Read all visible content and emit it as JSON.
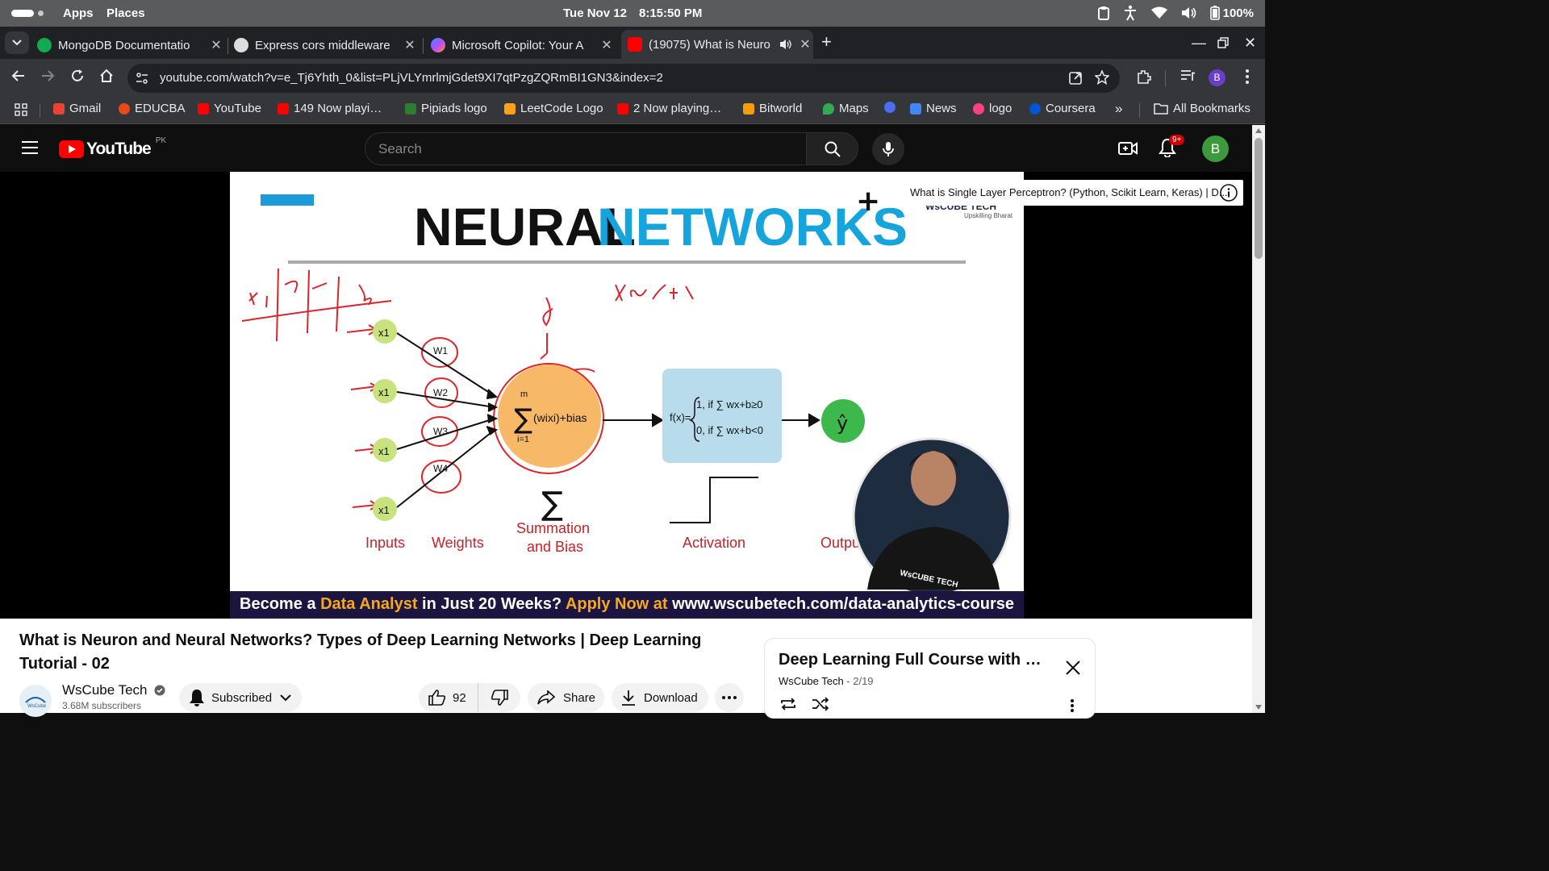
{
  "system_bar": {
    "menu": [
      "Apps",
      "Places"
    ],
    "date": "Tue Nov 12",
    "time": "8:15:50 PM",
    "battery": "100%"
  },
  "tabs": [
    {
      "title": "MongoDB Documentatio",
      "favicon_color": "#13aa52"
    },
    {
      "title": "Express cors middleware",
      "favicon_color": "#dddddd"
    },
    {
      "title": "Microsoft Copilot: Your A",
      "favicon_color": "#7b61ff"
    },
    {
      "title": "(19075) What is Neuro",
      "favicon_color": "#ff0000"
    }
  ],
  "address_bar": {
    "url": "youtube.com/watch?v=e_Tj6Yhth_0&list=PLjVLYmrlmjGdet9XI7qtPzgZQRmBI1GN3&index=2",
    "profile_initial": "B"
  },
  "bookmarks": [
    {
      "label": "Gmail",
      "color": "#ea4335"
    },
    {
      "label": "EDUCBA",
      "color": "#e64a19"
    },
    {
      "label": "YouTube",
      "color": "#ff0000"
    },
    {
      "label": "149 Now playi…",
      "color": "#ff0000"
    },
    {
      "label": "Pipiads logo",
      "color": "#2e7d32"
    },
    {
      "label": "LeetCode Logo",
      "color": "#ffa116"
    },
    {
      "label": "2 Now playing…",
      "color": "#ff0000"
    },
    {
      "label": "Bitworld",
      "color": "#f59e0b"
    },
    {
      "label": "Maps",
      "color": "#34a853"
    },
    {
      "label": "News",
      "color": "#4285f4"
    },
    {
      "label": "logo",
      "color": "#ff4081"
    },
    {
      "label": "Coursera",
      "color": "#0056d2"
    },
    {
      "label": "All Bookmarks",
      "color": "#e8eaed"
    }
  ],
  "youtube": {
    "logo_text": "YouTube",
    "region": "PK",
    "search_placeholder": "Search",
    "notifications_badge": "9+",
    "avatar_initial": "B"
  },
  "video": {
    "slide_title_part1": "NEURAL",
    "slide_title_part2": "NETWORKS",
    "slide_brand": "WsCUBE TECH",
    "slide_brand_sub": "Upskilling Bharat",
    "inputs": [
      "x1",
      "x1",
      "x1",
      "x1"
    ],
    "weights": [
      "W1",
      "W2",
      "W3",
      "W4"
    ],
    "sum_top": "m",
    "sum_text": "(wixi)+bias",
    "sum_bottom": "i=1",
    "func_label": "f(x)=",
    "func_case1": "1, if ∑ wx+b≥0",
    "func_case2": "0, if ∑ wx+b<0",
    "output_symbol": "ŷ",
    "labels": [
      "Inputs",
      "Weights",
      "Summation",
      "and Bias",
      "Activation",
      "Outpu"
    ],
    "banner_part1": "Become a ",
    "banner_part2": "Data Analyst",
    "banner_part3": " in Just 20 Weeks? ",
    "banner_part4": "Apply Now at ",
    "banner_part5": "www.wscubetech.com/data-analytics-course",
    "info_card": "What is Single Layer Perceptron? (Python, Scikit Learn, Keras) | D..."
  },
  "watch": {
    "title": "What is Neuron and Neural Networks? Types of Deep Learning Networks | Deep Learning Tutorial - 02",
    "channel": "WsCube Tech",
    "subscribers": "3.68M subscribers",
    "subscribe_label": "Subscribed",
    "likes": "92",
    "share_label": "Share",
    "download_label": "Download"
  },
  "playlist": {
    "title": "Deep Learning Full Course with …",
    "channel": "WsCube Tech",
    "position": " - 2/19"
  }
}
